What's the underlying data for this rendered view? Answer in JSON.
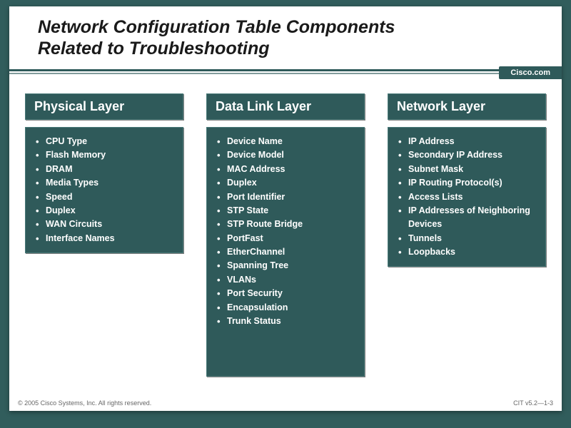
{
  "title_line1": "Network Configuration Table Components",
  "title_line2": "Related to Troubleshooting",
  "brand": "Cisco.com",
  "columns": [
    {
      "header": "Physical Layer",
      "items": [
        "CPU Type",
        "Flash Memory",
        "DRAM",
        "Media Types",
        "Speed",
        "Duplex",
        "WAN Circuits",
        "Interface Names"
      ]
    },
    {
      "header": "Data Link Layer",
      "items": [
        "Device Name",
        "Device Model",
        "MAC Address",
        "Duplex",
        "Port Identifier",
        "STP State",
        "STP Route Bridge",
        "PortFast",
        "EtherChannel",
        "Spanning Tree",
        "VLANs",
        "Port Security",
        "Encapsulation",
        "Trunk Status"
      ]
    },
    {
      "header": "Network Layer",
      "items": [
        "IP Address",
        "Secondary IP Address",
        "Subnet Mask",
        "IP Routing Protocol(s)",
        "Access Lists",
        "IP Addresses of Neighboring Devices",
        "Tunnels",
        "Loopbacks"
      ]
    }
  ],
  "footer": {
    "copyright": "© 2005 Cisco Systems, Inc. All rights reserved.",
    "slideref": "CIT v5.2—1-3"
  }
}
